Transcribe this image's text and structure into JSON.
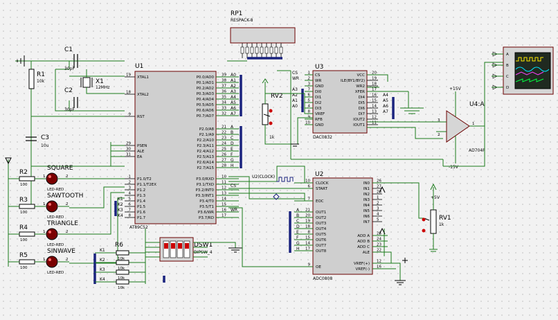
{
  "components": {
    "rp1": {
      "ref": "RP1",
      "value": "RESPACK-8"
    },
    "u1": {
      "ref": "U1",
      "value": "AT89C52",
      "pins_left": [
        {
          "num": "19",
          "name": "XTAL1"
        },
        {
          "num": "18",
          "name": "XTAL2"
        },
        {
          "num": "9",
          "name": "RST"
        },
        {
          "num": "29",
          "name": "PSEN"
        },
        {
          "num": "30",
          "name": "ALE"
        },
        {
          "num": "31",
          "name": "EA"
        },
        {
          "num": "1",
          "name": "P1.0/T2"
        },
        {
          "num": "2",
          "name": "P1.1/T2EX"
        },
        {
          "num": "3",
          "name": "P1.2"
        },
        {
          "num": "4",
          "name": "P1.3"
        },
        {
          "num": "5",
          "name": "P1.4"
        },
        {
          "num": "6",
          "name": "P1.5"
        },
        {
          "num": "7",
          "name": "P1.6"
        },
        {
          "num": "8",
          "name": "P1.7"
        }
      ],
      "pins_right": [
        {
          "num": "39",
          "name": "P0.0/AD0"
        },
        {
          "num": "38",
          "name": "P0.1/AD1"
        },
        {
          "num": "37",
          "name": "P0.2/AD2"
        },
        {
          "num": "36",
          "name": "P0.3/AD3"
        },
        {
          "num": "35",
          "name": "P0.4/AD4"
        },
        {
          "num": "34",
          "name": "P0.5/AD5"
        },
        {
          "num": "33",
          "name": "P0.6/AD6"
        },
        {
          "num": "32",
          "name": "P0.7/AD7"
        },
        {
          "num": "21",
          "name": "P2.0/A8"
        },
        {
          "num": "22",
          "name": "P2.1/A9"
        },
        {
          "num": "23",
          "name": "P2.2/A10"
        },
        {
          "num": "24",
          "name": "P2.3/A11"
        },
        {
          "num": "25",
          "name": "P2.4/A12"
        },
        {
          "num": "26",
          "name": "P2.5/A13"
        },
        {
          "num": "27",
          "name": "P2.6/A14"
        },
        {
          "num": "28",
          "name": "P2.7/A15"
        },
        {
          "num": "10",
          "name": "P3.0/RXD"
        },
        {
          "num": "11",
          "name": "P3.1/TXD"
        },
        {
          "num": "12",
          "name": "P3.2/INT0"
        },
        {
          "num": "13",
          "name": "P3.3/INT1"
        },
        {
          "num": "14",
          "name": "P3.4/T0"
        },
        {
          "num": "15",
          "name": "P3.5/T1"
        },
        {
          "num": "16",
          "name": "P3.6/WR"
        },
        {
          "num": "17",
          "name": "P3.7/RD"
        }
      ],
      "net_a": [
        "A0",
        "A1",
        "A2",
        "A3",
        "A4",
        "A5",
        "A6",
        "A7"
      ],
      "net_p2": [
        "A",
        "B",
        "C",
        "D",
        "E",
        "F",
        "G",
        "H"
      ],
      "net_p3": [
        "CS",
        "WR"
      ],
      "net_p1": [
        "K1",
        "K2",
        "K3",
        "K4"
      ]
    },
    "u3": {
      "ref": "U3",
      "value": "DAC0832",
      "pins_left": [
        {
          "num": "1",
          "name": "CS"
        },
        {
          "num": "2",
          "name": "WR"
        },
        {
          "num": "3",
          "name": "GND"
        },
        {
          "num": "7",
          "name": "DI0"
        },
        {
          "num": "6",
          "name": "DI1"
        },
        {
          "num": "5",
          "name": "DI2"
        },
        {
          "num": "4",
          "name": "DI3"
        },
        {
          "num": "8",
          "name": "VREF"
        },
        {
          "num": "9",
          "name": "RFB"
        },
        {
          "num": "10",
          "name": "GND"
        }
      ],
      "pins_right": [
        {
          "num": "20",
          "name": "VCC"
        },
        {
          "num": "19",
          "name": "ILE(BY1/BY2)"
        },
        {
          "num": "18",
          "name": "WR2"
        },
        {
          "num": "17",
          "name": "XFER"
        },
        {
          "num": "16",
          "name": "DI4"
        },
        {
          "num": "15",
          "name": "DI5"
        },
        {
          "num": "14",
          "name": "DI6"
        },
        {
          "num": "13",
          "name": "DI7"
        },
        {
          "num": "12",
          "name": "IOUT2"
        },
        {
          "num": "11",
          "name": "IOUT1"
        }
      ],
      "net_left": [
        "CS",
        "WR",
        "A3",
        "A2",
        "A1",
        "A0"
      ],
      "net_right": [
        "A4",
        "A5",
        "A6",
        "A7"
      ]
    },
    "u2": {
      "ref": "U2",
      "value": "ADC0808",
      "pins_left": [
        {
          "num": "10",
          "name": "CLOCK"
        },
        {
          "num": "6",
          "name": "START"
        },
        {
          "num": "7",
          "name": "EOC"
        },
        {
          "num": "21",
          "name": "OUT1"
        },
        {
          "num": "20",
          "name": "OUT2"
        },
        {
          "num": "19",
          "name": "OUT3"
        },
        {
          "num": "18",
          "name": "OUT4"
        },
        {
          "num": "8",
          "name": "OUT5"
        },
        {
          "num": "15",
          "name": "OUT6"
        },
        {
          "num": "14",
          "name": "OUT7"
        },
        {
          "num": "17",
          "name": "OUT8"
        },
        {
          "num": "9",
          "name": "OE"
        }
      ],
      "pins_right": [
        {
          "num": "26",
          "name": "IN0"
        },
        {
          "num": "27",
          "name": "IN1"
        },
        {
          "num": "28",
          "name": "IN2"
        },
        {
          "num": "1",
          "name": "IN3"
        },
        {
          "num": "2",
          "name": "IN4"
        },
        {
          "num": "3",
          "name": "IN5"
        },
        {
          "num": "4",
          "name": "IN6"
        },
        {
          "num": "5",
          "name": "IN7"
        },
        {
          "num": "25",
          "name": "ADD A"
        },
        {
          "num": "24",
          "name": "ADD B"
        },
        {
          "num": "23",
          "name": "ADD C"
        },
        {
          "num": "22",
          "name": "ALE"
        },
        {
          "num": "12",
          "name": "VREF(+)"
        },
        {
          "num": "16",
          "name": "VREF(-)"
        }
      ],
      "net_left": [
        "A",
        "B",
        "C",
        "D",
        "E",
        "F",
        "G",
        "H"
      ],
      "clock_label": "U2(CLOCK)"
    },
    "u4": {
      "ref": "U4:A",
      "value": "AD704P",
      "pin_plus": "3",
      "pin_minus": "2",
      "pin_out": "1",
      "vpos": "+15V",
      "vneg": "-15V"
    },
    "c1": {
      "ref": "C1",
      "value": "30pF"
    },
    "c2": {
      "ref": "C2",
      "value": "30pF"
    },
    "c3": {
      "ref": "C3",
      "value": "10u"
    },
    "x1": {
      "ref": "X1",
      "value": "12MHz"
    },
    "r1": {
      "ref": "R1",
      "value": "10k"
    },
    "rv2": {
      "ref": "RV2",
      "value": "1k"
    },
    "rv1": {
      "ref": "RV1",
      "value": "1k"
    },
    "rv1_supply": "+5V",
    "r6": {
      "ref": "R6",
      "values": [
        "10k",
        "10k",
        "10k",
        "10k"
      ],
      "nets": [
        "K1",
        "K2",
        "K3",
        "K4"
      ]
    },
    "dsw1": {
      "ref": "DSW1",
      "value": "DIPSW_4"
    },
    "leds": [
      {
        "name": "SQUARE",
        "ref": "R2",
        "value": "100",
        "type": "LED-RED"
      },
      {
        "name": "SAWTOOTH",
        "ref": "R3",
        "value": "100",
        "type": "LED-RED"
      },
      {
        "name": "TRIANGLE",
        "ref": "R4",
        "value": "100",
        "type": "LED-RED"
      },
      {
        "name": "SINWAVE",
        "ref": "R5",
        "value": "100",
        "type": "LED-RED"
      }
    ],
    "scope": {
      "channels": [
        "A",
        "B",
        "C",
        "D"
      ]
    },
    "pin_numbers": {
      "one": "1",
      "two": "2"
    }
  },
  "colors": {
    "wire": "#1a7a1a",
    "bus": "#1a237e",
    "chip_fill": "#cfcfcf",
    "chip_border": "#6b0000",
    "led": "#7a0000",
    "scope_a": "#ffea00",
    "scope_b": "#00e5ff",
    "scope_c": "#ff40ff",
    "scope_d": "#00ff40"
  }
}
